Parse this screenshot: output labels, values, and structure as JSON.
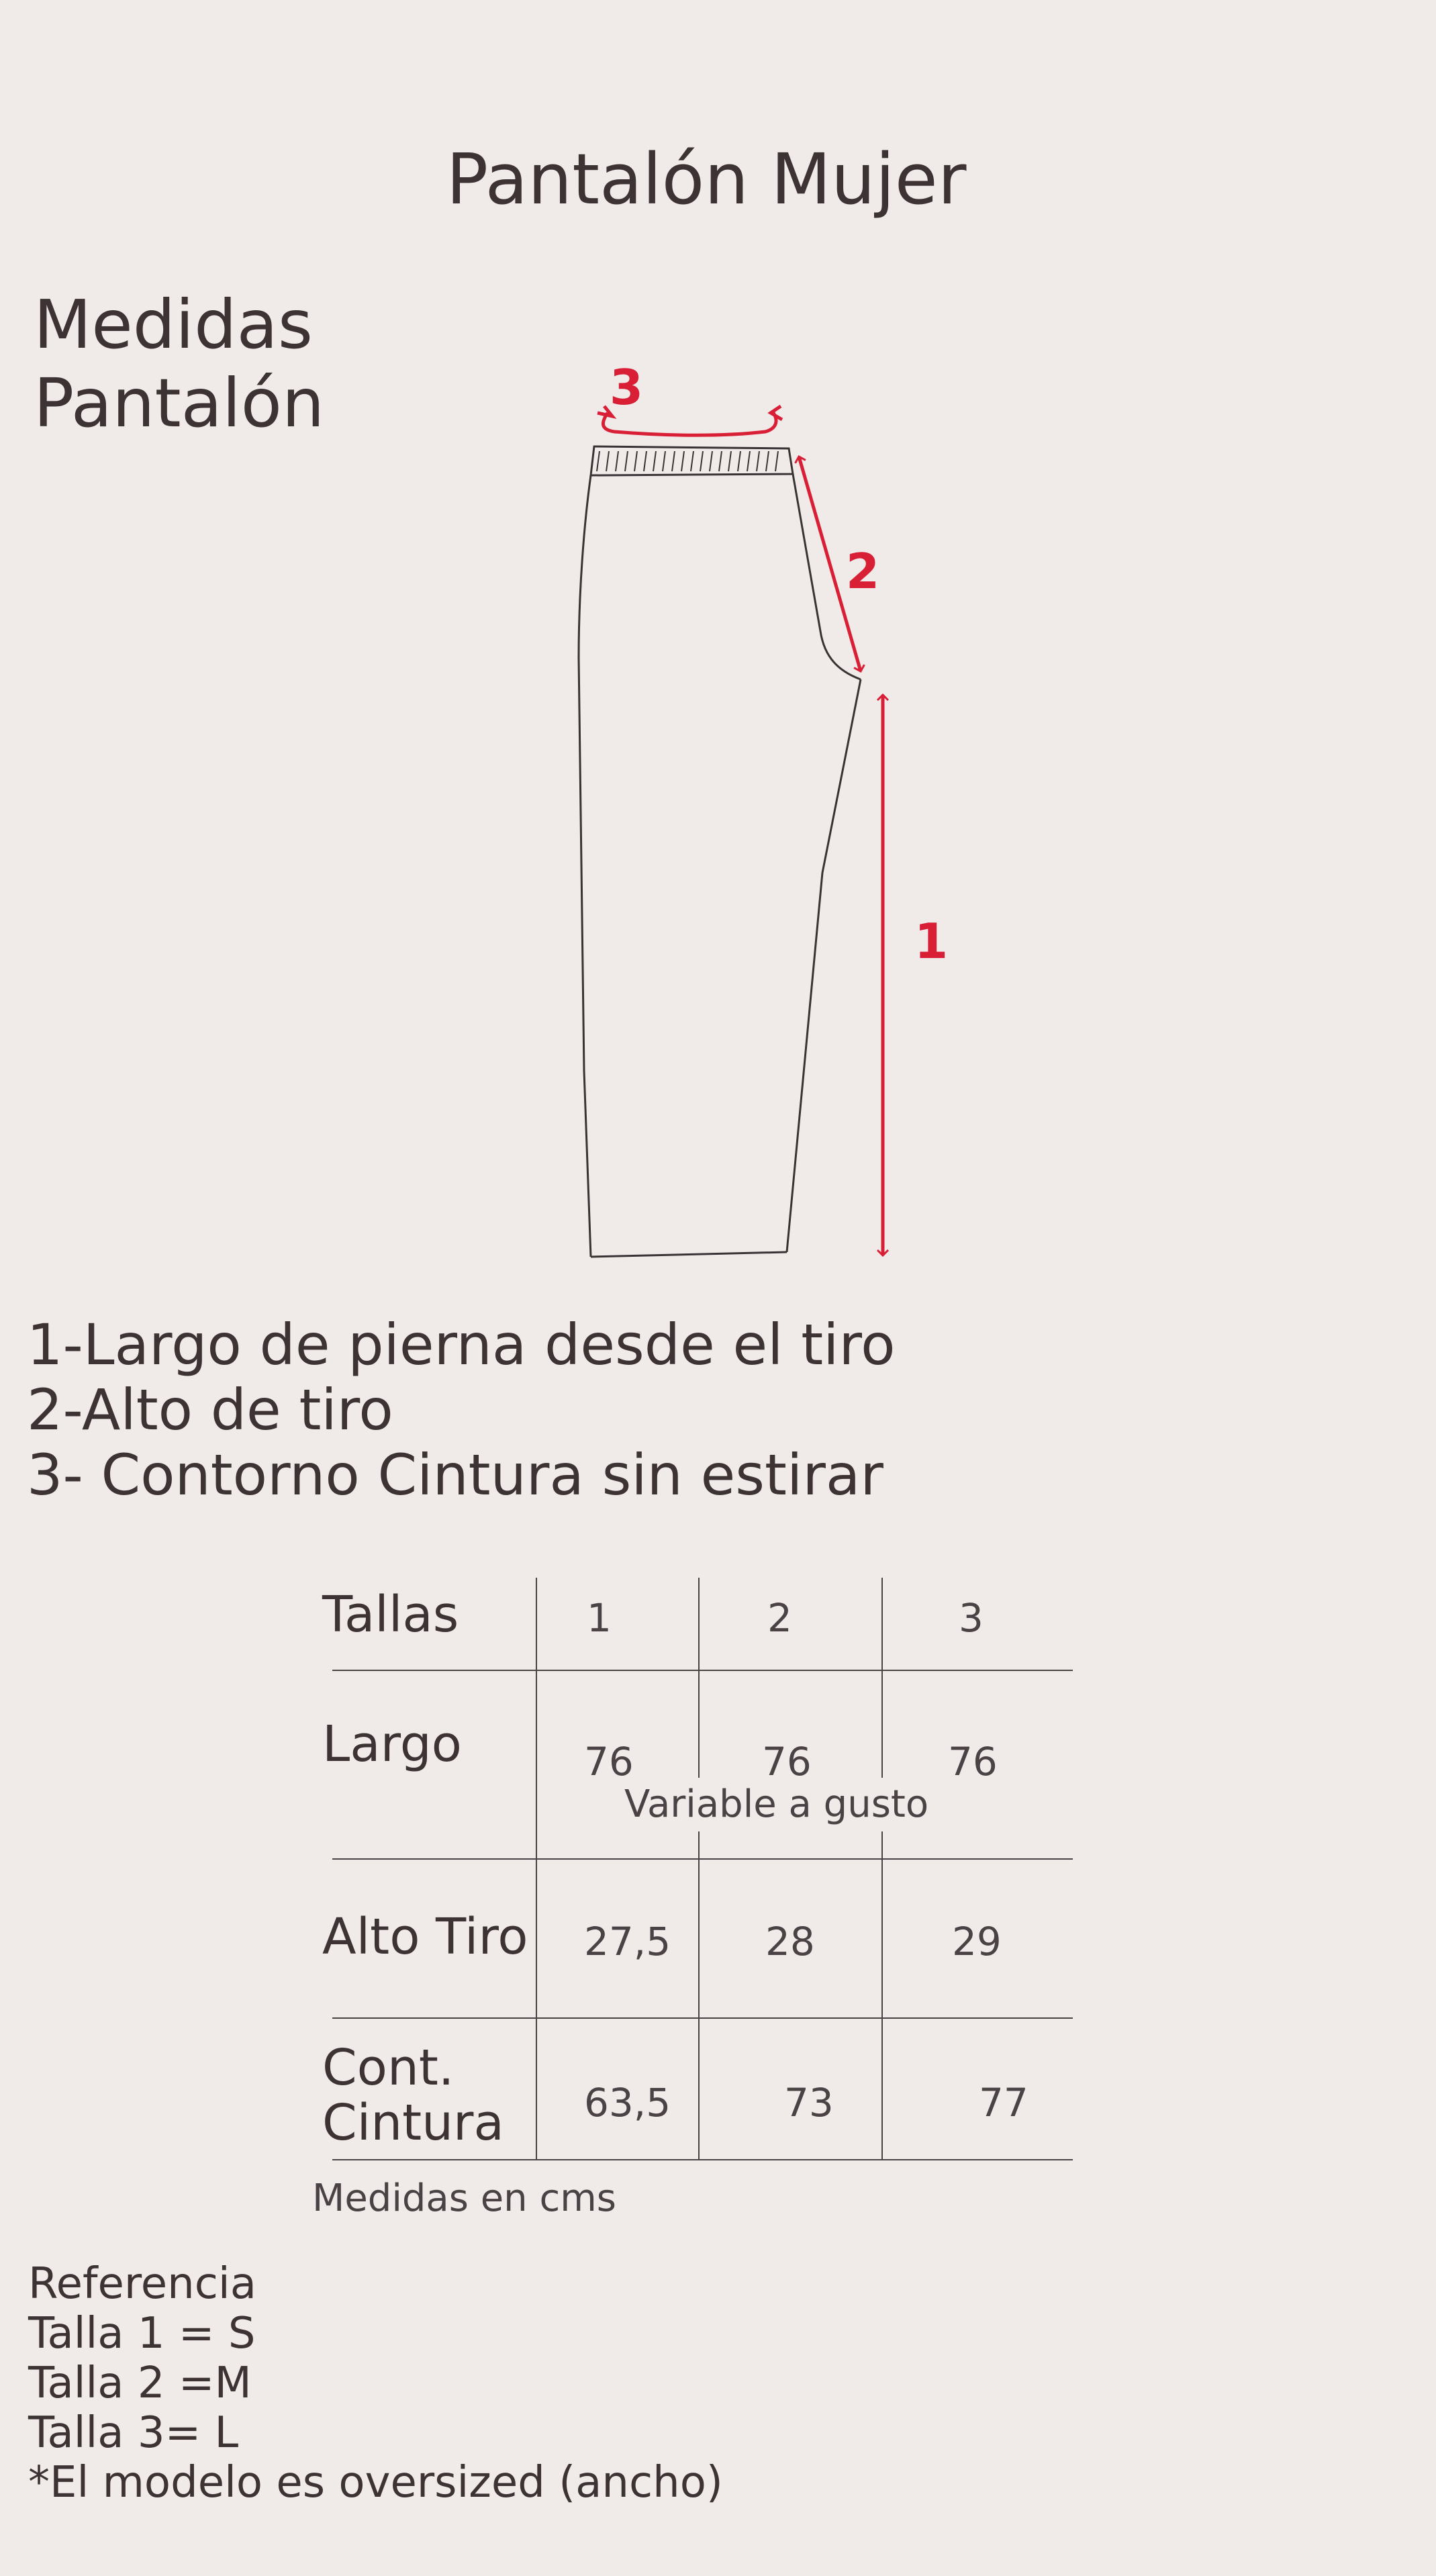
{
  "title": "Pantalón Mujer",
  "section_title": [
    "Medidas",
    "Pantalón"
  ],
  "diagram_labels": {
    "leg_length": "1",
    "rise": "2",
    "waist": "3"
  },
  "legend": [
    "1-Largo de pierna desde el tiro",
    "2-Alto de tiro",
    "3- Contorno Cintura sin estirar"
  ],
  "table": {
    "header": "Tallas",
    "sizes": [
      "1",
      "2",
      "3"
    ],
    "rows": [
      {
        "label": [
          "Largo"
        ],
        "values": [
          "76",
          "76",
          "76"
        ],
        "note": "Variable a gusto"
      },
      {
        "label": [
          "Alto Tiro"
        ],
        "values": [
          "27,5",
          "28",
          "29"
        ]
      },
      {
        "label": [
          "Cont.",
          "Cintura"
        ],
        "values": [
          "63,5",
          "73",
          "77"
        ]
      }
    ],
    "units_note": "Medidas en cms"
  },
  "references": [
    "Referencia",
    "Talla 1 = S",
    "Talla 2 =M",
    "Talla 3= L",
    "*El modelo es oversized (ancho)"
  ],
  "colors": {
    "accent": "#d81f35",
    "text": "#3d3335",
    "background": "#f0ebe9"
  }
}
